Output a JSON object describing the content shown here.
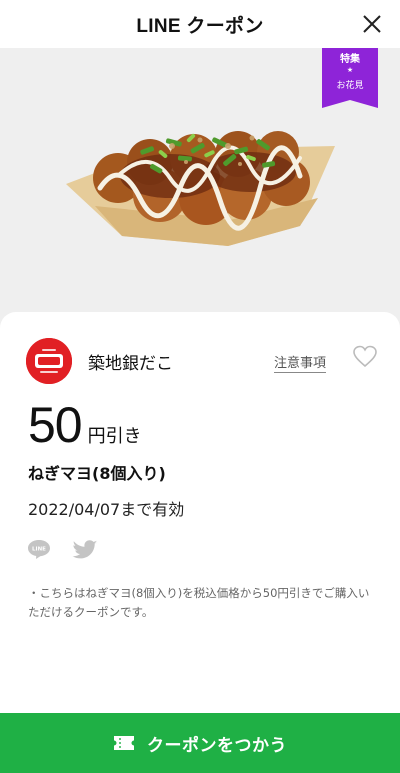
{
  "header": {
    "title": "LINE クーポン",
    "close_icon": "close-icon"
  },
  "hero": {
    "badge": {
      "line1": "特集",
      "star": "★",
      "line2": "お花見",
      "color": "#8e24d8"
    }
  },
  "coupon": {
    "brand_name": "築地銀だこ",
    "notes_label": "注意事項",
    "discount_value": "50",
    "discount_unit": "円引き",
    "product": "ねぎマヨ(8個入り)",
    "validity": "2022/04/07まで有効",
    "share_icons": [
      "line-share-icon",
      "twitter-share-icon"
    ],
    "terms": "・こちらはねぎマヨ(8個入り)を税込価格から50円引きでご購入いただけるクーポンです。"
  },
  "cta": {
    "label": "クーポンをつかう",
    "icon": "ticket-icon",
    "color": "#1fb045"
  }
}
